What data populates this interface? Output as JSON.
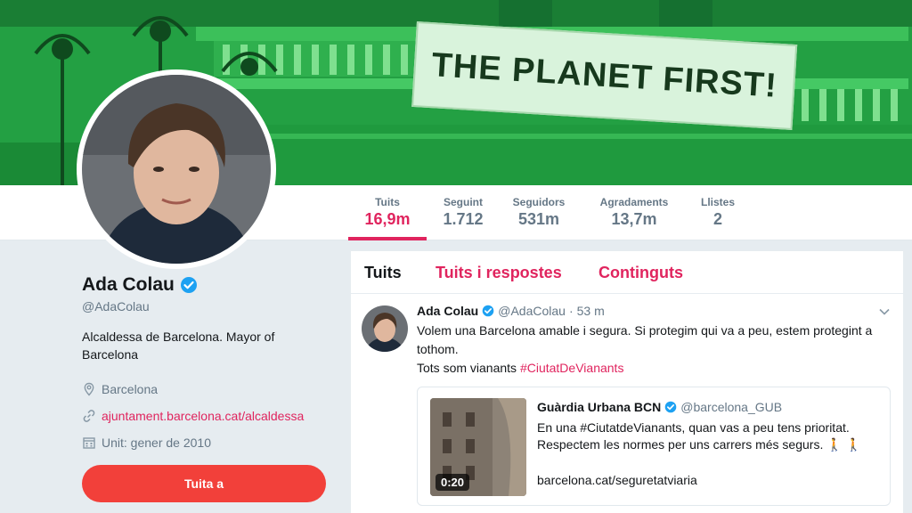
{
  "banner": {
    "sign_text": "THE PLANET FIRST!"
  },
  "nav": {
    "stats": [
      {
        "label": "Tuits",
        "value": "16,9m"
      },
      {
        "label": "Seguint",
        "value": "1.712"
      },
      {
        "label": "Seguidors",
        "value": "531m"
      },
      {
        "label": "Agradaments",
        "value": "13,7m"
      },
      {
        "label": "Llistes",
        "value": "2"
      }
    ]
  },
  "profile": {
    "name": "Ada Colau",
    "handle": "@AdaColau",
    "bio": "Alcaldessa de Barcelona. Mayor of Barcelona",
    "location": "Barcelona",
    "website": "ajuntament.barcelona.cat/alcaldessa",
    "joined": "Unit: gener de 2010",
    "tweet_button": "Tuita a"
  },
  "timeline": {
    "tabs": [
      "Tuits",
      "Tuits i respostes",
      "Continguts"
    ],
    "tweet": {
      "name": "Ada Colau",
      "handle": "@AdaColau",
      "time": "53 m",
      "text": "Volem una Barcelona amable i segura. Si protegim qui va a peu, estem protegint a tothom.",
      "text2": "Tots som vianants",
      "hashtag": "#CiutatDeVianants",
      "card": {
        "name": "Guàrdia Urbana BCN",
        "handle": "@barcelona_GUB",
        "text": "En una #CiutatdeVianants, quan vas a peu tens prioritat. Respectem les normes per uns carrers més segurs. 🚶 🚶",
        "link": "barcelona.cat/seguretatviaria",
        "duration": "0:20"
      }
    }
  },
  "colors": {
    "accent": "#e0245e",
    "button": "#f2403a",
    "banner": "#27a845"
  }
}
